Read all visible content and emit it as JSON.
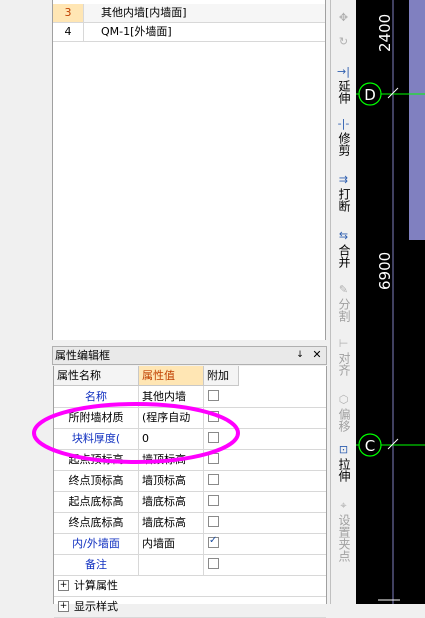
{
  "wall_list": {
    "rows": [
      {
        "num": "3",
        "name": "其他内墙[内墙面]",
        "selected": true
      },
      {
        "num": "4",
        "name": "QM-1[外墙面]",
        "selected": false
      }
    ]
  },
  "property_panel": {
    "title": "属性编辑框",
    "pin_icon": "pin-icon",
    "close_icon": "close-icon",
    "headers": {
      "name": "属性名称",
      "value": "属性值",
      "attach": "附加"
    },
    "rows": [
      {
        "name": "名称",
        "value": "其他内墙",
        "attach": false,
        "blue": true
      },
      {
        "name": "所附墙材质",
        "value": "(程序自动",
        "attach": false,
        "blue": false
      },
      {
        "name": "块料厚度(",
        "value": "0",
        "attach": false,
        "blue": true
      },
      {
        "name": "起点顶标高",
        "value": "墙顶标高",
        "attach": false,
        "blue": false
      },
      {
        "name": "终点顶标高",
        "value": "墙顶标高",
        "attach": false,
        "blue": false
      },
      {
        "name": "起点底标高",
        "value": "墙底标高",
        "attach": false,
        "blue": false
      },
      {
        "name": "终点底标高",
        "value": "墙底标高",
        "attach": false,
        "blue": false
      },
      {
        "name": "内/外墙面",
        "value": "内墙面",
        "attach": true,
        "blue": true
      },
      {
        "name": "备注",
        "value": "",
        "attach": false,
        "blue": true
      }
    ],
    "groups": [
      {
        "name": "计算属性"
      },
      {
        "name": "显示样式"
      }
    ]
  },
  "toolbar": {
    "extend": "延伸",
    "trim": "修剪",
    "break": "打断",
    "merge": "合并",
    "split": "分割",
    "align": "对齐",
    "offset": "偏移",
    "stretch": "拉伸",
    "set_node": "设置夹点"
  },
  "canvas": {
    "dim_top": "2400",
    "dim_mid": "6900",
    "axis_d": "D",
    "axis_c": "C",
    "colors": {
      "background": "#000000",
      "axis_circle": "#00ff00",
      "dimension": "#ffffff",
      "wall": "#8080c0"
    }
  },
  "annotation": {
    "color": "#ff00ff"
  }
}
